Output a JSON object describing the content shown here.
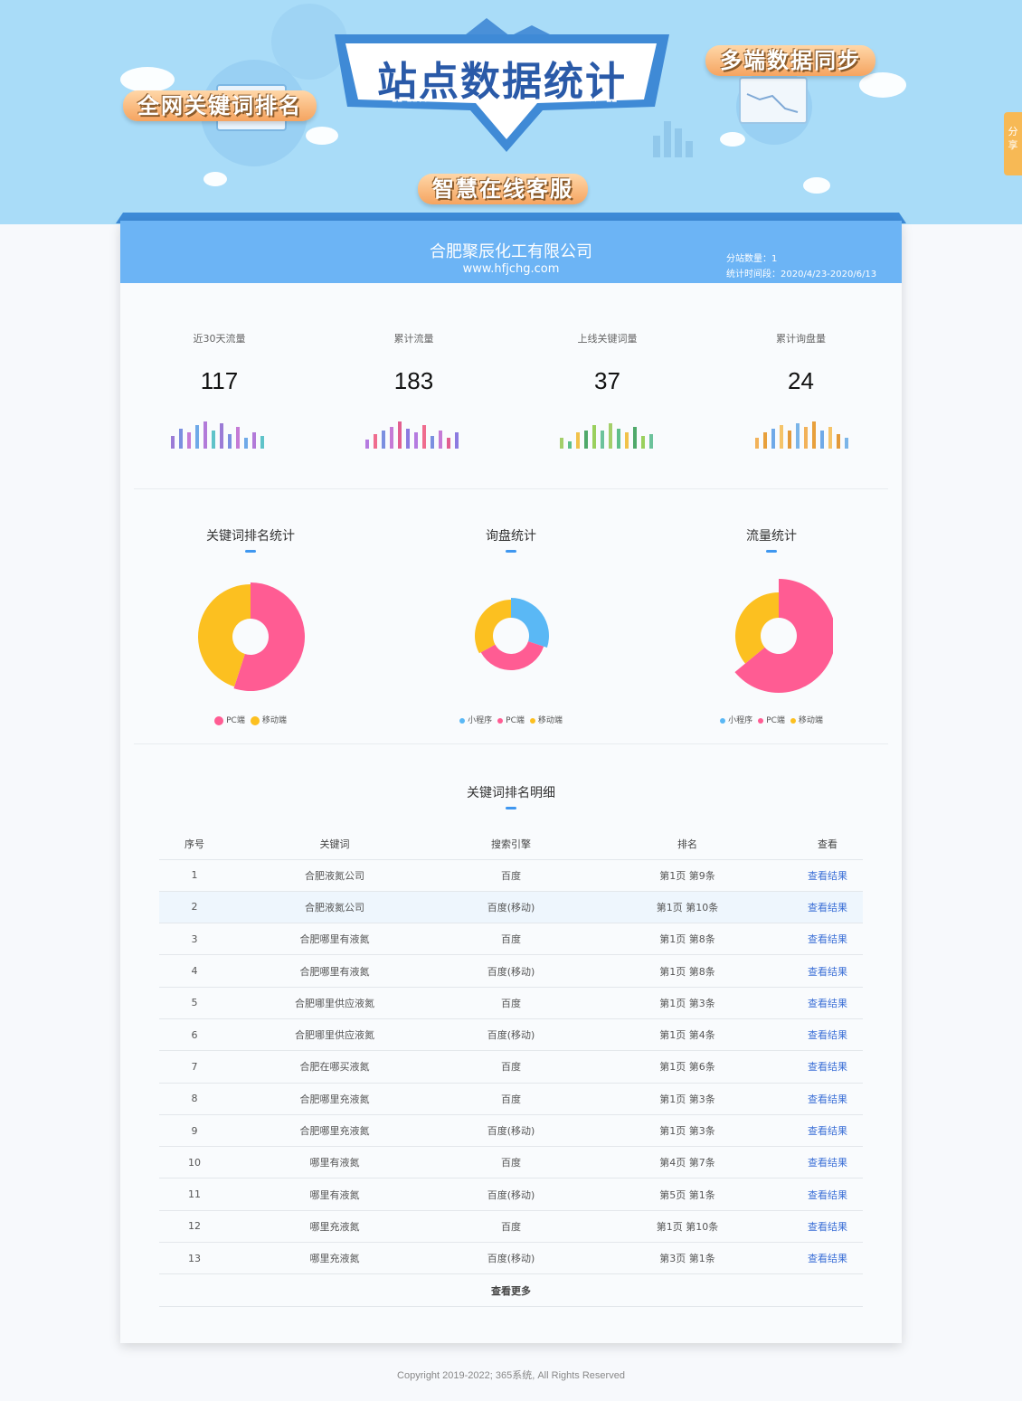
{
  "banner": {
    "title": "站点数据统计",
    "ribbon_left": "全网关键词排名",
    "ribbon_right": "多端数据同步",
    "ribbon_bottom": "智慧在线客服",
    "share": "分享"
  },
  "header": {
    "company": "合肥聚辰化工有限公司",
    "site": "www.hfjchg.com",
    "site_count": "分站数量：1",
    "period": "统计时间段：2020/4/23-2020/6/13"
  },
  "stats": [
    {
      "label": "近30天流量",
      "value": "117"
    },
    {
      "label": "累计流量",
      "value": "183"
    },
    {
      "label": "上线关键词量",
      "value": "37"
    },
    {
      "label": "累计询盘量",
      "value": "24"
    }
  ],
  "charts_text": {
    "keyword_rank": "关键词排名统计",
    "inquiry": "询盘统计",
    "traffic": "流量统计"
  },
  "chart_data": [
    {
      "type": "pie",
      "title": "关键词排名统计",
      "categories": [
        "PC端",
        "移动端"
      ],
      "values": [
        55,
        45
      ],
      "colors": [
        "#ff5c93",
        "#fcc020"
      ]
    },
    {
      "type": "pie",
      "title": "询盘统计",
      "categories": [
        "小程序",
        "PC端",
        "移动端"
      ],
      "values": [
        30,
        37,
        33
      ],
      "colors": [
        "#5ab8f5",
        "#ff5c93",
        "#fcc020"
      ]
    },
    {
      "type": "pie",
      "title": "流量统计",
      "categories": [
        "小程序",
        "PC端",
        "移动端"
      ],
      "values": [
        0,
        64,
        36
      ],
      "colors": [
        "#5ab8f5",
        "#ff5c93",
        "#fcc020"
      ]
    }
  ],
  "table": {
    "title": "关键词排名明细",
    "headers": [
      "序号",
      "关键词",
      "搜索引擎",
      "排名",
      "查看"
    ],
    "link_label": "查看结果",
    "more": "查看更多",
    "rows": [
      [
        "1",
        "合肥液氮公司",
        "百度",
        "第1页 第9条"
      ],
      [
        "2",
        "合肥液氮公司",
        "百度(移动)",
        "第1页 第10条"
      ],
      [
        "3",
        "合肥哪里有液氮",
        "百度",
        "第1页 第8条"
      ],
      [
        "4",
        "合肥哪里有液氮",
        "百度(移动)",
        "第1页 第8条"
      ],
      [
        "5",
        "合肥哪里供应液氮",
        "百度",
        "第1页 第3条"
      ],
      [
        "6",
        "合肥哪里供应液氮",
        "百度(移动)",
        "第1页 第4条"
      ],
      [
        "7",
        "合肥在哪买液氮",
        "百度",
        "第1页 第6条"
      ],
      [
        "8",
        "合肥哪里充液氮",
        "百度",
        "第1页 第3条"
      ],
      [
        "9",
        "合肥哪里充液氮",
        "百度(移动)",
        "第1页 第3条"
      ],
      [
        "10",
        "哪里有液氮",
        "百度",
        "第4页 第7条"
      ],
      [
        "11",
        "哪里有液氮",
        "百度(移动)",
        "第5页 第1条"
      ],
      [
        "12",
        "哪里充液氮",
        "百度",
        "第1页 第10条"
      ],
      [
        "13",
        "哪里充液氮",
        "百度(移动)",
        "第3页 第1条"
      ]
    ]
  },
  "footer": "Copyright 2019-2022; 365系统, All Rights Reserved"
}
